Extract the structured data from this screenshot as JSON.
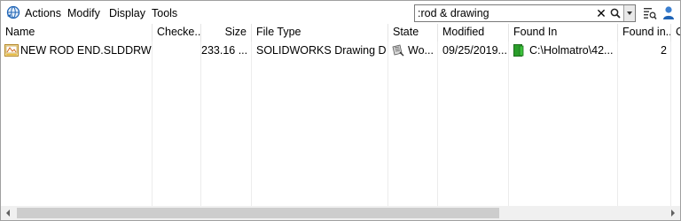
{
  "menu": {
    "items": [
      "Actions",
      "Modify",
      "Display",
      "Tools"
    ]
  },
  "search": {
    "value": ":rod & drawing",
    "clear_symbol": "✕"
  },
  "icons": {
    "app": "globe-arrow-icon",
    "file": "slddrw-file-icon",
    "state": "workflow-state-icon",
    "folder": "vault-folder-icon",
    "search": "magnifier-icon",
    "search_options": "list-search-icon",
    "user": "user-icon"
  },
  "colors": {
    "folder_green": "#2a9d2a",
    "app_blue": "#1e63b5",
    "file_yellow": "#e7b93a"
  },
  "table": {
    "columns": [
      "Name",
      "Checke...",
      "Size",
      "File Type",
      "State",
      "Modified",
      "Found In",
      "Found in...",
      "C"
    ],
    "rows": [
      {
        "name": "NEW ROD END.SLDDRW",
        "checked_out": "",
        "size": "233.16 ...",
        "file_type": "SOLIDWORKS Drawing D...",
        "state": "Wo...",
        "modified": "09/25/2019...",
        "found_in": "C:\\Holmatro\\42...",
        "found_in_count": "2"
      }
    ]
  }
}
